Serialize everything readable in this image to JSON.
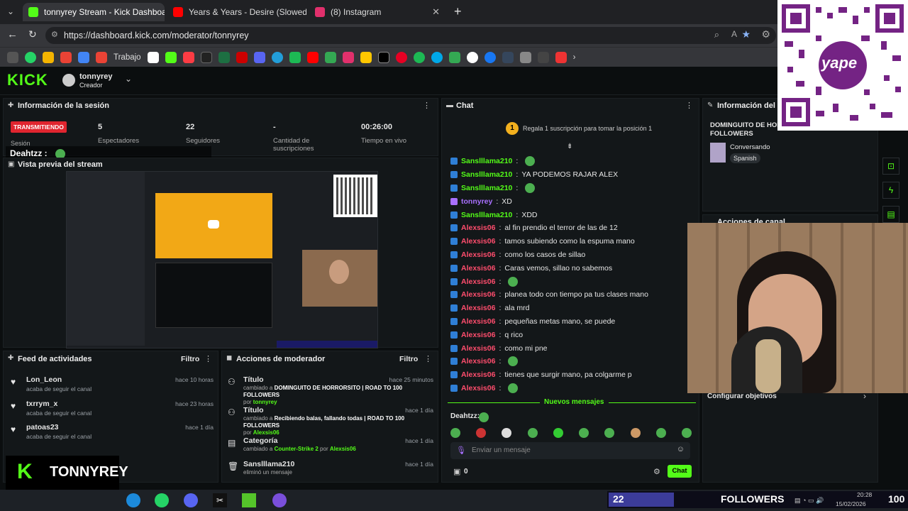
{
  "browser": {
    "tabs": [
      {
        "title": "tonnyrey Stream - Kick Dashboard",
        "active": true,
        "color": "#53fc18"
      },
      {
        "title": "Years & Years - Desire (Slowed) - Y",
        "active": false,
        "color": "#ff0000"
      },
      {
        "title": "(8) Instagram",
        "active": false,
        "color": "#e1306c"
      }
    ],
    "new_tab": "+",
    "url": "https://dashboard.kick.com/moderator/tonnyrey",
    "bookmark_label": "Trabajo"
  },
  "kick": {
    "logo": "KICK",
    "user": {
      "name": "tonnyrey",
      "role": "Creador"
    }
  },
  "session": {
    "title": "Información de la sesión",
    "status": "TRANSMITIENDO",
    "status_sub": "Sesión",
    "stats": [
      {
        "value": "5",
        "label": "Espectadores"
      },
      {
        "value": "22",
        "label": "Seguidores"
      },
      {
        "value": "-",
        "label": "Cantidad de suscripciones"
      },
      {
        "value": "00:26:00",
        "label": "Tiempo en vivo"
      }
    ],
    "overlay_user": "Deahtzz :",
    "preview_title": "Vista previa del stream"
  },
  "feed": {
    "title": "Feed de actividades",
    "filter": "Filtro",
    "items": [
      {
        "name": "Lon_Leon",
        "sub": "acaba de seguir el canal",
        "time": "hace 10 horas"
      },
      {
        "name": "txrrym_x",
        "sub": "acaba de seguir el canal",
        "time": "hace 23 horas"
      },
      {
        "name": "patoas23",
        "sub": "acaba de seguir el canal",
        "time": "hace 1 día"
      }
    ]
  },
  "mod": {
    "title": "Acciones de moderador",
    "filter": "Filtro",
    "items": [
      {
        "title": "Título",
        "time": "hace 25 minutos",
        "pre": "cambiado a ",
        "value": "DOMINGUITO DE HORRORSITO | ROAD TO 100 FOLLOWERS",
        "by": "por ",
        "user": "tonnyrey"
      },
      {
        "title": "Título",
        "time": "hace 1 día",
        "pre": "cambiado a ",
        "value": "Recibiendo balas, fallando todas | ROAD TO 100 FOLLOWERS",
        "by": "por ",
        "user": "Alexsis06"
      },
      {
        "title": "Categoría",
        "time": "hace 1 día",
        "pre": "cambiado a ",
        "value": "Counter-Strike 2",
        "by": " por ",
        "user": "Alexsis06"
      },
      {
        "title": "Sanslllama210",
        "time": "hace 1 día",
        "pre": "eliminó un mensaje",
        "value": "",
        "by": "",
        "user": ""
      }
    ]
  },
  "chat": {
    "title": "Chat",
    "pinned_count": "1",
    "pinned_text": "Regala 1 suscripción para tomar la posición 1",
    "messages": [
      {
        "user": "Sanslllama210",
        "text": "",
        "color": "#53fc18"
      },
      {
        "user": "Sanslllama210",
        "text": "YA PODEMOS RAJAR ALEX",
        "color": "#53fc18"
      },
      {
        "user": "Sanslllama210",
        "text": "",
        "color": "#53fc18"
      },
      {
        "user": "tonnyrey",
        "text": "XD",
        "color": "#a970ff"
      },
      {
        "user": "Sanslllama210",
        "text": "XDD",
        "color": "#53fc18"
      },
      {
        "user": "Alexsis06",
        "text": "al fin prendio el terror de las de 12",
        "color": "#ff4d6d"
      },
      {
        "user": "Alexsis06",
        "text": "tamos subiendo como la espuma mano",
        "color": "#ff4d6d"
      },
      {
        "user": "Alexsis06",
        "text": "como los casos de sillao",
        "color": "#ff4d6d"
      },
      {
        "user": "Alexsis06",
        "text": "Caras vemos, sillao no sabemos",
        "color": "#ff4d6d"
      },
      {
        "user": "Alexsis06",
        "text": "",
        "color": "#ff4d6d"
      },
      {
        "user": "Alexsis06",
        "text": "planea todo con tiempo pa tus clases mano",
        "color": "#ff4d6d"
      },
      {
        "user": "Alexsis06",
        "text": "ala mrd",
        "color": "#ff4d6d"
      },
      {
        "user": "Alexsis06",
        "text": "pequeñas metas mano, se puede",
        "color": "#ff4d6d"
      },
      {
        "user": "Alexsis06",
        "text": "q rico",
        "color": "#ff4d6d"
      },
      {
        "user": "Alexsis06",
        "text": "como mi pne",
        "color": "#ff4d6d"
      },
      {
        "user": "Alexsis06",
        "text": "",
        "color": "#ff4d6d"
      },
      {
        "user": "Alexsis06",
        "text": "tienes que surgir mano, pa colgarme p",
        "color": "#ff4d6d"
      },
      {
        "user": "Alexsis06",
        "text": "",
        "color": "#ff4d6d"
      }
    ],
    "new_messages": "Nuevos mensajes",
    "typing_user": "Deahtzz:",
    "input_placeholder": "Enviar un mensaje",
    "counter": "0",
    "send": "Chat"
  },
  "info": {
    "title": "Información del strea",
    "stream_title": "DOMINGUITO DE HORR FOLLOWERS",
    "category": "Conversando",
    "language": "Spanish",
    "actions_title": "Acciones de canal",
    "goals": "Configurar objetivos"
  },
  "overlay": {
    "brand": "TONNYREY",
    "followers_count": "22",
    "followers_label": "FOLLOWERS",
    "followers_goal": "100",
    "followers_fraction": 0.22,
    "yape": "yape"
  },
  "taskbar": {
    "time": "20:28",
    "date": "15/02/2026"
  }
}
